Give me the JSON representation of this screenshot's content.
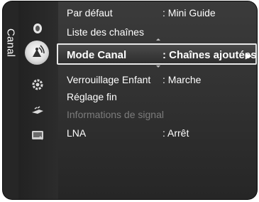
{
  "menu": {
    "side_title": "Canal",
    "icons": [
      {
        "name": "picture-icon",
        "active": false
      },
      {
        "name": "channel-icon",
        "active": true
      },
      {
        "name": "setup-icon",
        "active": false
      },
      {
        "name": "input-icon",
        "active": false
      },
      {
        "name": "application-icon",
        "active": false
      }
    ],
    "items": [
      {
        "label": "Par défaut",
        "value": ": Mini Guide"
      },
      {
        "label": "Liste des chaînes",
        "value": ""
      },
      {
        "label": "Mode Canal",
        "value": ": Chaînes ajoutées",
        "arrow": "▶"
      },
      {
        "label": "Verrouillage Enfant",
        "value": ": Marche"
      },
      {
        "label": "Réglage fin",
        "value": ""
      },
      {
        "label": "Informations de signal",
        "value": ""
      },
      {
        "label": "LNA",
        "value": ": Arrêt"
      }
    ]
  }
}
